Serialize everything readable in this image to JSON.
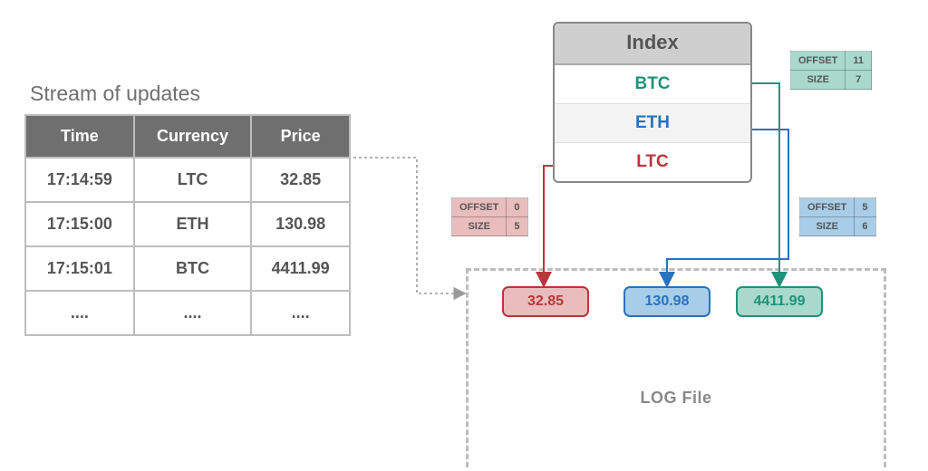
{
  "stream": {
    "title": "Stream of updates",
    "headers": {
      "time": "Time",
      "currency": "Currency",
      "price": "Price"
    },
    "rows": [
      {
        "time": "17:14:59",
        "currency": "LTC",
        "price": "32.85"
      },
      {
        "time": "17:15:00",
        "currency": "ETH",
        "price": "130.98"
      },
      {
        "time": "17:15:01",
        "currency": "BTC",
        "price": "4411.99"
      },
      {
        "time": "....",
        "currency": "....",
        "price": "...."
      }
    ]
  },
  "index": {
    "title": "Index",
    "items": [
      "BTC",
      "ETH",
      "LTC"
    ]
  },
  "offsets": {
    "btc": {
      "offset_label": "OFFSET",
      "offset": "11",
      "size_label": "SIZE",
      "size": "7"
    },
    "eth": {
      "offset_label": "OFFSET",
      "offset": "5",
      "size_label": "SIZE",
      "size": "6"
    },
    "ltc": {
      "offset_label": "OFFSET",
      "offset": "0",
      "size_label": "SIZE",
      "size": "5"
    }
  },
  "log": {
    "title": "LOG File",
    "entries": {
      "ltc": "32.85",
      "eth": "130.98",
      "btc": "4411.99"
    }
  }
}
